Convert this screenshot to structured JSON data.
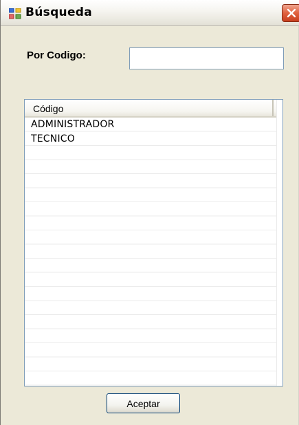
{
  "window": {
    "title": "Búsqueda",
    "icon": "form-window-icon",
    "close_icon": "close-x-icon",
    "close_color": "#e0613f"
  },
  "search": {
    "label": "Por Codigo:",
    "value": "",
    "placeholder": ""
  },
  "listview": {
    "columns": [
      "Código"
    ],
    "rows": [
      {
        "codigo": "ADMINISTRADOR"
      },
      {
        "codigo": "TECNICO"
      }
    ]
  },
  "buttons": {
    "accept_label": "Aceptar"
  }
}
